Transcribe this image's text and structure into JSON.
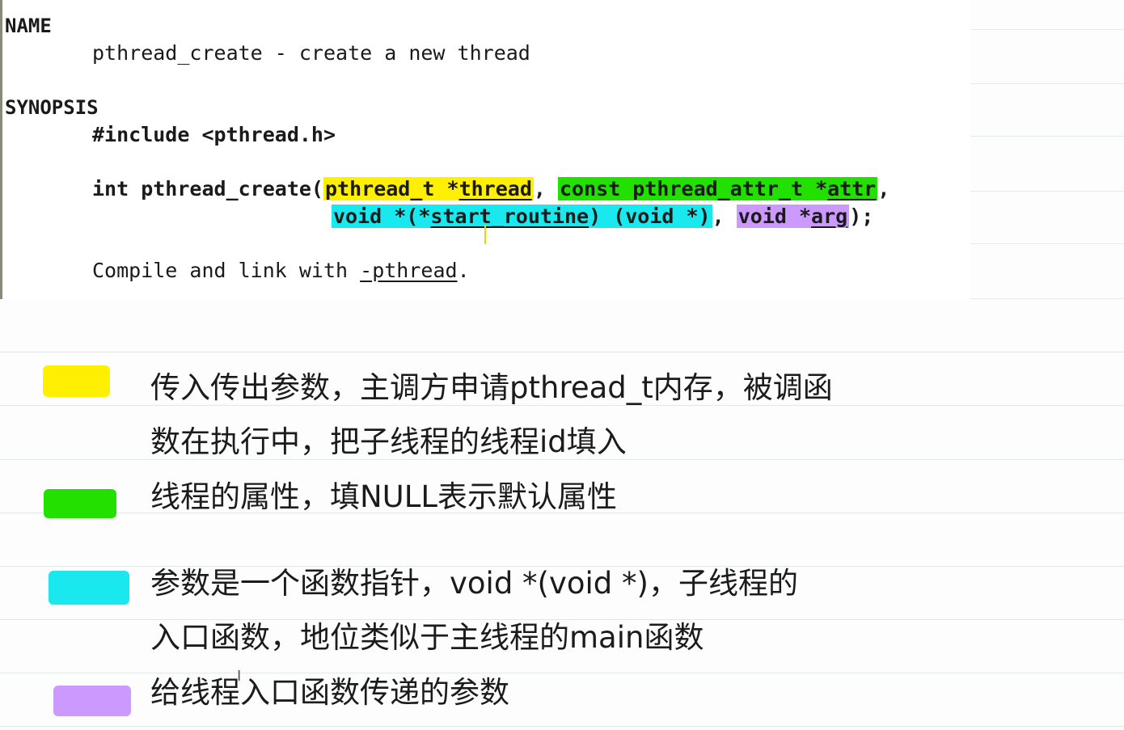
{
  "man": {
    "name_heading": "NAME",
    "name_line": "pthread_create - create a new thread",
    "synopsis_heading": "SYNOPSIS",
    "include_line": "#include <pthread.h>",
    "proto_prefix": "int pthread_create(",
    "p1_type": "pthread_t *",
    "p1_name": "thread",
    "comma1": ",",
    "p2_type": "const pthread_attr_t *",
    "p2_name": "attr",
    "comma2": ",",
    "p3_pre": "void *(*",
    "p3_name": "start_routine",
    "p3_post": ") (void *)",
    "comma3": ",",
    "p4_type": "void *",
    "p4_name": "arg",
    "proto_end": ");",
    "compile_prefix": "Compile and link with ",
    "compile_flag": "-pthread",
    "compile_end": "."
  },
  "legend": [
    {
      "color": "#ffef00",
      "lines": [
        "传入传出参数，主调方申请pthread_t内存，被调函",
        "数在执行中，把子线程的线程id填入"
      ]
    },
    {
      "color": "#22e000",
      "lines": [
        "线程的属性，填NULL表示默认属性"
      ]
    },
    {
      "color": "#19e8ef",
      "lines": [
        "参数是一个函数指针，void *(void *)，子线程的",
        "入口函数，地位类似于主线程的main函数"
      ]
    },
    {
      "color": "#cc99ff",
      "lines": [
        "给线程入口函数传递的参数"
      ]
    }
  ],
  "icons": {
    "cursor": "text-cursor-icon",
    "ibeam_glyph": "I"
  }
}
